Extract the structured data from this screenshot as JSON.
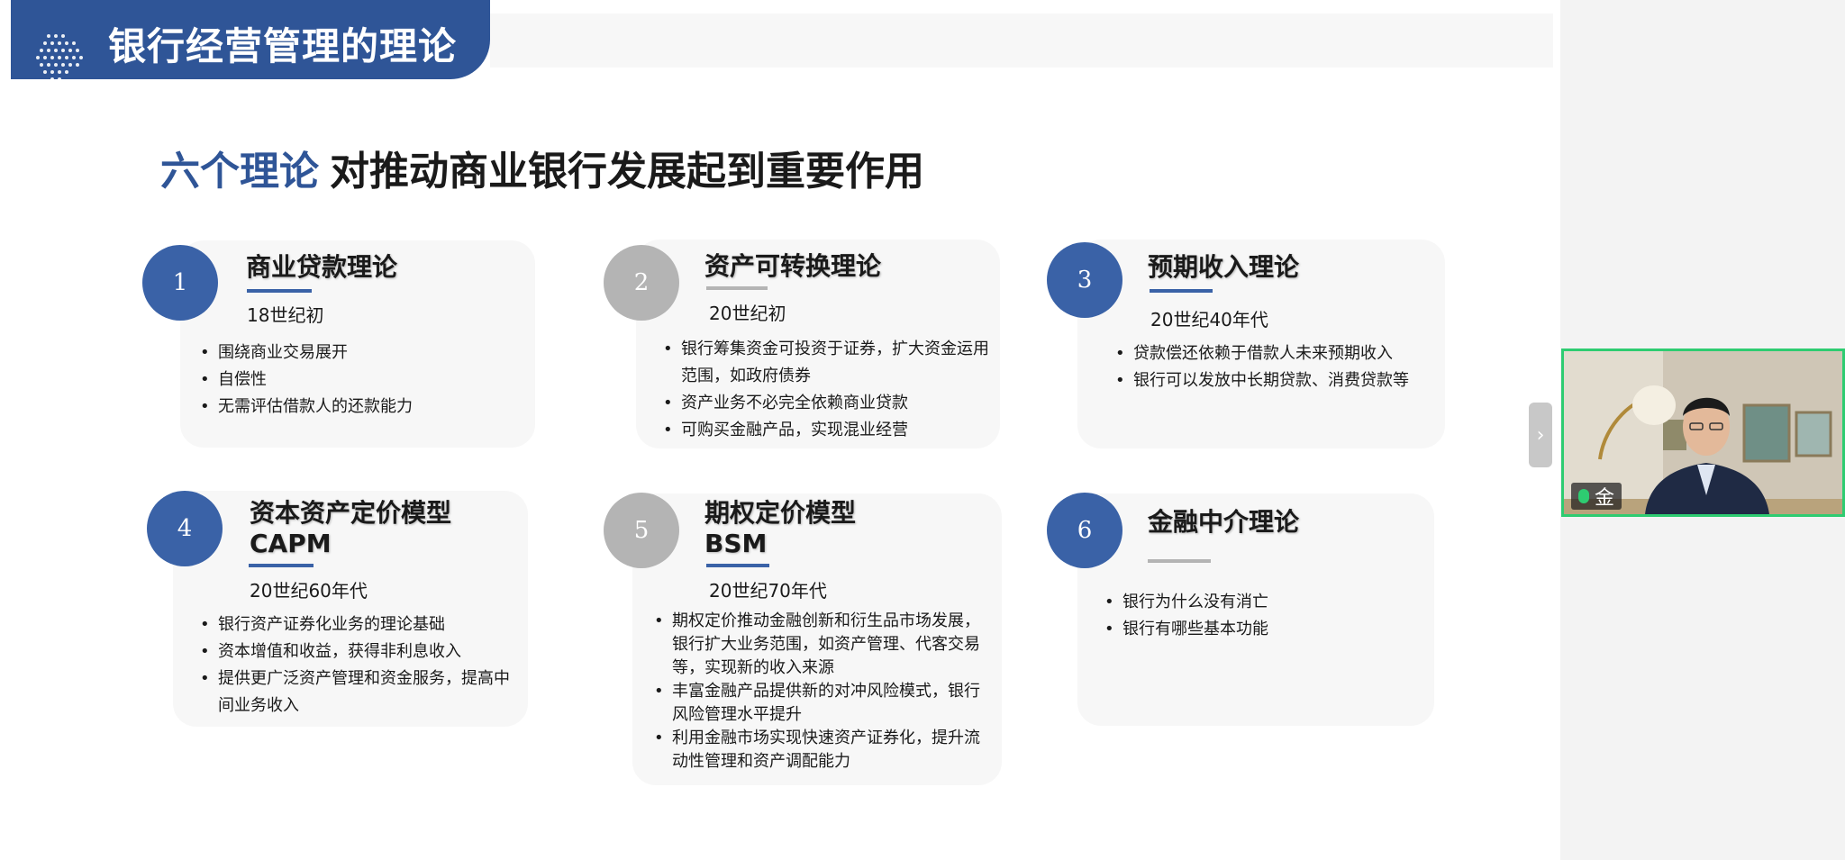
{
  "slide": {
    "header_title": "银行经营管理的理论",
    "subtitle_accent": "六个理论",
    "subtitle_rest": "对推动商业银行发展起到重要作用"
  },
  "cards": [
    {
      "number": "1",
      "title_line1": "商业贷款理论",
      "title_line2": "",
      "era": "18世纪初",
      "points": [
        "围绕商业交易展开",
        "自偿性",
        "无需评估借款人的还款能力"
      ]
    },
    {
      "number": "2",
      "title_line1": "资产可转换理论",
      "title_line2": "",
      "era": "20世纪初",
      "points": [
        "银行筹集资金可投资于证券，扩大资金运用范围，如政府债券",
        "资产业务不必完全依赖商业贷款",
        "可购买金融产品，实现混业经营"
      ]
    },
    {
      "number": "3",
      "title_line1": "预期收入理论",
      "title_line2": "",
      "era": "20世纪40年代",
      "points": [
        "贷款偿还依赖于借款人未来预期收入",
        "银行可以发放中长期贷款、消费贷款等"
      ]
    },
    {
      "number": "4",
      "title_line1": "资本资产定价模型",
      "title_line2": "CAPM",
      "era": "20世纪60年代",
      "points": [
        "银行资产证券化业务的理论基础",
        "资本增值和收益，获得非利息收入",
        "提供更广泛资产管理和资金服务，提高中间业务收入"
      ]
    },
    {
      "number": "5",
      "title_line1": "期权定价模型",
      "title_line2": "BSM",
      "era": "20世纪70年代",
      "points": [
        "期权定价推动金融创新和衍生品市场发展，银行扩大业务范围，如资产管理、代客交易等，实现新的收入来源",
        "丰富金融产品提供新的对冲风险模式，银行风险管理水平提升",
        "利用金融市场实现快速资产证券化，提升流动性管理和资产调配能力"
      ]
    },
    {
      "number": "6",
      "title_line1": "金融中介理论",
      "title_line2": "",
      "era": "",
      "points": [
        "银行为什么没有消亡",
        "银行有哪些基本功能"
      ]
    }
  ],
  "video": {
    "participant_name": "金",
    "mic_icon": "microphone-icon"
  },
  "navigation": {
    "next_icon": "chevron-right-icon",
    "glyph": "›"
  },
  "colors": {
    "accent_blue": "#2f5597",
    "circle_blue": "#3a62a7",
    "circle_gray": "#b4b4b4",
    "active_speaker_border": "#2ecc71"
  }
}
